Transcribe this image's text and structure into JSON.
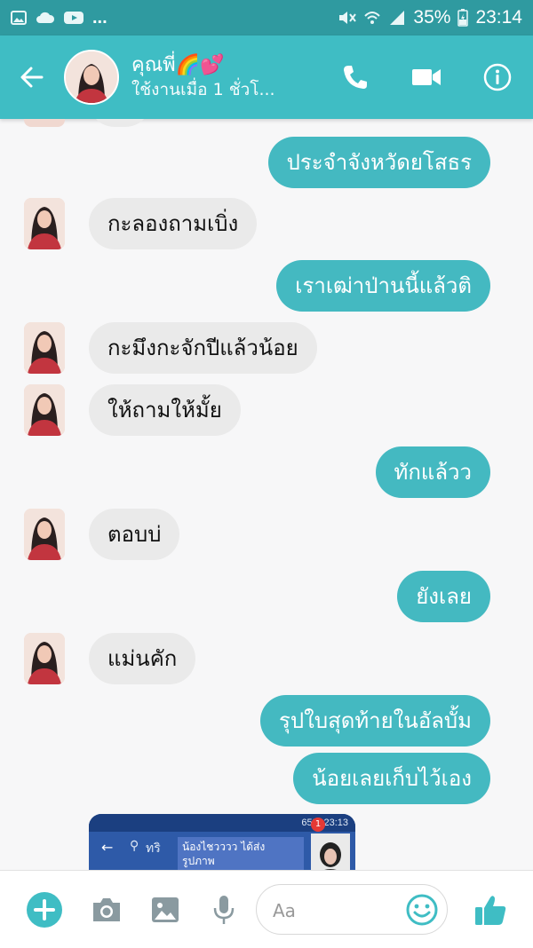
{
  "status_bar": {
    "battery": "35%",
    "time": "23:14",
    "dots": "..."
  },
  "header": {
    "contact_name": "คุณพี่🌈💕",
    "contact_status": "ใช้งานเมื่อ 1 ชั่วโ...",
    "accent_color": "#3fbdc4"
  },
  "messages": [
    {
      "side": "out",
      "text": "ประจำจังหวัดยโสธร"
    },
    {
      "side": "in",
      "text": "กะลองถามเบิ่ง"
    },
    {
      "side": "out",
      "text": "เราเฒ่าป่านนี้แล้วติ"
    },
    {
      "side": "in",
      "text": "กะมึงกะจักปีแล้วน้อย"
    },
    {
      "side": "in",
      "text": "ให้ถามให้มั้ย"
    },
    {
      "side": "out",
      "text": "ทักแล้วว"
    },
    {
      "side": "in",
      "text": "ตอบบ่"
    },
    {
      "side": "out",
      "text": "ยังเลย"
    },
    {
      "side": "in",
      "text": "แม่นคัก"
    },
    {
      "side": "out",
      "text": "รุปใบสุดท้ายในอัลบั้ม"
    },
    {
      "side": "out",
      "text": "น้อยเลยเก็บไว้เอง"
    }
  ],
  "shared_image": {
    "status_text": "65% 23:13",
    "search_text": "ทริ",
    "notification_text": "น้องไชวววว ได้ส่ง รูปภาพ",
    "badge_count": "1"
  },
  "composer": {
    "placeholder": "Aa"
  },
  "icons": {
    "back": "arrow-left-icon",
    "call": "phone-icon",
    "video": "video-camera-icon",
    "info": "info-icon",
    "add": "plus-circle-icon",
    "camera": "camera-icon",
    "gallery": "image-icon",
    "mic": "microphone-icon",
    "emoji": "smiley-icon",
    "like": "thumbs-up-icon"
  }
}
